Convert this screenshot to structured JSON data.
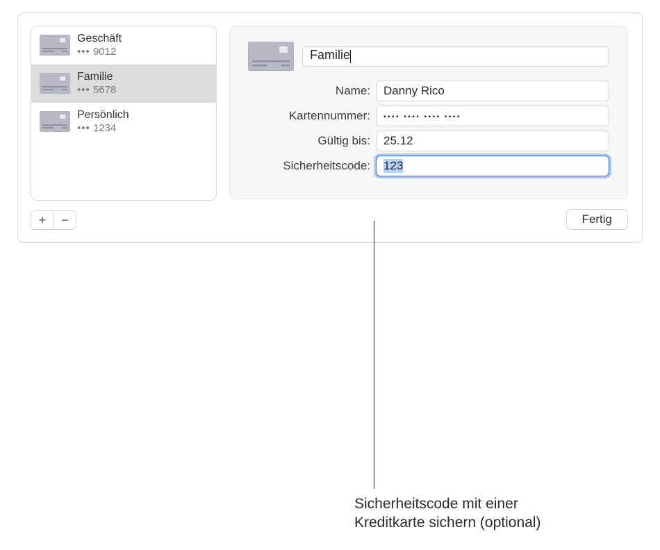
{
  "sidebar": {
    "items": [
      {
        "title": "Geschäft",
        "last4": "9012",
        "selected": false
      },
      {
        "title": "Familie",
        "last4": "5678",
        "selected": true
      },
      {
        "title": "Persönlich",
        "last4": "1234",
        "selected": false
      }
    ],
    "add_symbol": "+",
    "remove_symbol": "−"
  },
  "detail": {
    "card_title_value": "Familie",
    "labels": {
      "name": "Name:",
      "number": "Kartennummer:",
      "expiry": "Gültig bis:",
      "security": "Sicherheitscode:"
    },
    "values": {
      "name": "Danny Rico",
      "number_mask": "•••• •••• •••• ••••",
      "expiry": "25.12",
      "security_selected": "123"
    }
  },
  "footer": {
    "done": "Fertig"
  },
  "callout": {
    "line1": "Sicherheitscode mit einer",
    "line2": "Kreditkarte sichern (optional)"
  },
  "dots_prefix": "•••"
}
